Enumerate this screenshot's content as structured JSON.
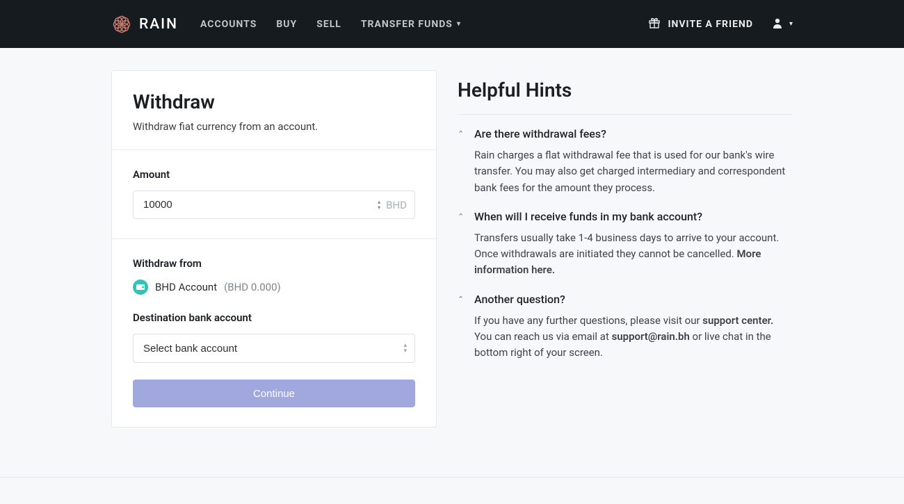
{
  "brand": {
    "name": "RAIN"
  },
  "nav": {
    "accounts": "ACCOUNTS",
    "buy": "BUY",
    "sell": "SELL",
    "transfer": "TRANSFER FUNDS"
  },
  "header": {
    "invite": "INVITE A FRIEND"
  },
  "withdraw": {
    "title": "Withdraw",
    "subtitle": "Withdraw fiat currency from an account.",
    "amount_label": "Amount",
    "amount_value": "10000",
    "currency": "BHD",
    "from_label": "Withdraw from",
    "account_name": "BHD Account",
    "account_balance": "(BHD 0.000)",
    "dest_label": "Destination bank account",
    "dest_placeholder": "Select bank account",
    "continue": "Continue"
  },
  "hints": {
    "title": "Helpful Hints",
    "items": [
      {
        "q": "Are there withdrawal fees?",
        "a": "Rain charges a flat withdrawal fee that is used for our bank's wire transfer. You may also get charged intermediary and correspondent bank fees for the amount they process."
      },
      {
        "q": "When will I receive funds in my bank account?",
        "a_pre": "Transfers usually take 1-4 business days to arrive to your account. Once withdrawals are initiated they cannot be cancelled. ",
        "a_link": "More information here."
      },
      {
        "q": "Another question?",
        "a3_1": "If you have any further questions, please visit our ",
        "a3_link1": "support center.",
        "a3_2": " You can reach us via email at ",
        "a3_link2": "support@rain.bh",
        "a3_3": " or live chat in the bottom right of your screen."
      }
    ]
  }
}
